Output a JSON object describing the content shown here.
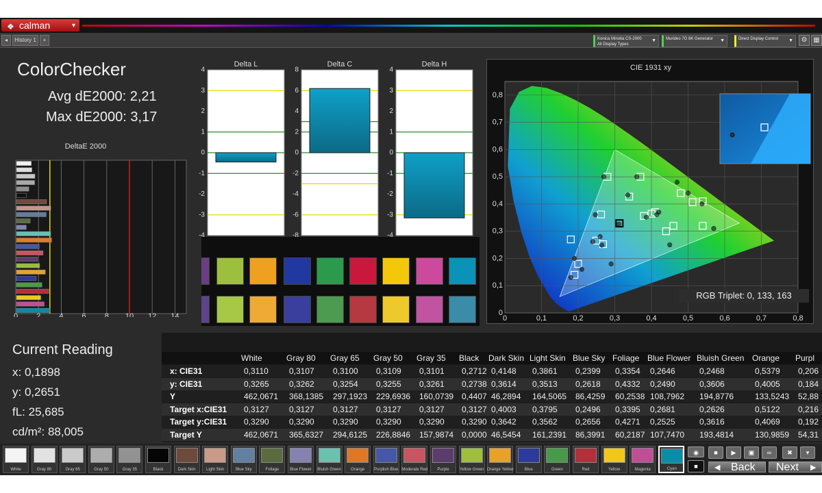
{
  "app": {
    "logo": "calman"
  },
  "tabs": {
    "history": "History 1",
    "add": "+"
  },
  "devices": {
    "meter": {
      "line1": "Konica Minolta CS-2000",
      "line2": "All Display Types"
    },
    "generator": {
      "line1": "Murideo 7G 8K Generator",
      "line2": ""
    },
    "display": {
      "line1": "Direct Display Control",
      "line2": ""
    }
  },
  "colorchecker": {
    "title": "ColorChecker",
    "avg": "Avg dE2000: 2,21",
    "max": "Max dE2000: 3,17"
  },
  "deltae_chart": {
    "title": "DeltaE 2000",
    "ticks": [
      "0",
      "2",
      "4",
      "6",
      "8",
      "10",
      "12",
      "14"
    ],
    "xlim": [
      0,
      15
    ],
    "thresholds": [
      {
        "value": 3,
        "color": "#e6d800"
      },
      {
        "value": 10,
        "color": "#d02020"
      }
    ],
    "bars": [
      {
        "name": "White",
        "value": 1.3694,
        "color": "#f2f2f2"
      },
      {
        "name": "Gray 80",
        "value": 1.4193,
        "color": "#dedede"
      },
      {
        "name": "Gray 65",
        "value": 1.6878,
        "color": "#c6c6c6"
      },
      {
        "name": "Gray 50",
        "value": 1.6602,
        "color": "#a9a9a9"
      },
      {
        "name": "Gray 35",
        "value": 1.1564,
        "color": "#8e8e8e"
      },
      {
        "name": "Black",
        "value": 0.9417,
        "color": "#101010"
      },
      {
        "name": "Dark Skin",
        "value": 2.7084,
        "color": "#6e4b3d"
      },
      {
        "name": "Light Skin",
        "value": 3.0778,
        "color": "#c69684"
      },
      {
        "name": "Blue Sky",
        "value": 2.6777,
        "color": "#5f7ea5"
      },
      {
        "name": "Foliage",
        "value": 1.2718,
        "color": "#5a6d3f"
      },
      {
        "name": "Blue Flower",
        "value": 0.9271,
        "color": "#8684b4"
      },
      {
        "name": "Bluish Green",
        "value": 3.0726,
        "color": "#67c1ae"
      },
      {
        "name": "Orange",
        "value": 3.1534,
        "color": "#e07a27"
      },
      {
        "name": "Purplish Blue",
        "value": 2.06,
        "color": "#4358a8"
      },
      {
        "name": "Moderate Red",
        "value": 2.4,
        "color": "#c95563"
      },
      {
        "name": "Purple",
        "value": 1.9,
        "color": "#5a3c6c"
      },
      {
        "name": "Yellow Green",
        "value": 2.1,
        "color": "#9dbb3c"
      },
      {
        "name": "Orange Yellow",
        "value": 2.6,
        "color": "#e9a12a"
      },
      {
        "name": "Blue",
        "value": 1.8,
        "color": "#2b3a9a"
      },
      {
        "name": "Green",
        "value": 2.3,
        "color": "#4a9a4a"
      },
      {
        "name": "Red",
        "value": 2.9,
        "color": "#b3303a"
      },
      {
        "name": "Yellow",
        "value": 2.2,
        "color": "#efc81f"
      },
      {
        "name": "Magenta",
        "value": 2.5,
        "color": "#c04f97"
      },
      {
        "name": "Cyan",
        "value": 3.0,
        "color": "#0e88aa"
      }
    ]
  },
  "delta_charts": [
    {
      "title": "Delta L",
      "ticks": [
        "4",
        "3",
        "2",
        "1",
        "0",
        "-1",
        "-2",
        "-3",
        "-4"
      ],
      "ylim": [
        -4,
        4
      ],
      "value": -0.45
    },
    {
      "title": "Delta C",
      "ticks": [
        "8",
        "6",
        "4",
        "2",
        "0",
        "-2",
        "-4",
        "-6",
        "-8"
      ],
      "ylim": [
        -8,
        8
      ],
      "value": 6.2
    },
    {
      "title": "Delta H",
      "ticks": [
        "4",
        "3",
        "2",
        "1",
        "0",
        "-1",
        "-2",
        "-3",
        "-4"
      ],
      "ylim": [
        -4,
        4
      ],
      "value": -3.15
    }
  ],
  "swatch_rows": {
    "top": [
      "#6a3e80",
      "#9cc03e",
      "#f0a020",
      "#2038a0",
      "#2c9a4c",
      "#c8193c",
      "#f5c70a",
      "#cc4a9e",
      "#0a92b8"
    ],
    "bottom": [
      "#5c4488",
      "#a6c846",
      "#eeaa35",
      "#3a3f9e",
      "#4d9b50",
      "#b63840",
      "#eec92c",
      "#c054a0",
      "#3a8ca8"
    ],
    "labels": [
      "le",
      "Yellow Green",
      "Orange Yellow",
      "Blue",
      "Green",
      "Red",
      "Yellow",
      "Magenta",
      "Cyan"
    ]
  },
  "cie": {
    "title": "CIE 1931 xy",
    "xticks": [
      "0",
      "0,1",
      "0,2",
      "0,3",
      "0,4",
      "0,5",
      "0,6",
      "0,7",
      "0,8"
    ],
    "yticks": [
      "0,8",
      "0,7",
      "0,6",
      "0,5",
      "0,4",
      "0,3",
      "0,2",
      "0,1",
      "0"
    ],
    "rgb_triplet": "RGB Triplet: 0, 133, 163",
    "targets": [
      [
        0.3127,
        0.329
      ],
      [
        0.4003,
        0.3642
      ],
      [
        0.3795,
        0.3562
      ],
      [
        0.2496,
        0.2656
      ],
      [
        0.3395,
        0.4271
      ],
      [
        0.2681,
        0.2525
      ],
      [
        0.2626,
        0.3616
      ],
      [
        0.5122,
        0.4069
      ],
      [
        0.2,
        0.18
      ],
      [
        0.44,
        0.3
      ],
      [
        0.19,
        0.14
      ],
      [
        0.48,
        0.44
      ],
      [
        0.54,
        0.41
      ],
      [
        0.37,
        0.5
      ],
      [
        0.54,
        0.32
      ],
      [
        0.41,
        0.37
      ],
      [
        0.28,
        0.5
      ],
      [
        0.18,
        0.27
      ],
      [
        0.46,
        0.32
      ]
    ],
    "measured": [
      [
        0.311,
        0.3265
      ],
      [
        0.4148,
        0.3614
      ],
      [
        0.3861,
        0.3513
      ],
      [
        0.2399,
        0.2618
      ],
      [
        0.3354,
        0.4332
      ],
      [
        0.2646,
        0.249
      ],
      [
        0.2468,
        0.3606
      ],
      [
        0.5379,
        0.4005
      ],
      [
        0.19,
        0.2
      ],
      [
        0.45,
        0.25
      ],
      [
        0.18,
        0.13
      ],
      [
        0.47,
        0.48
      ],
      [
        0.57,
        0.31
      ],
      [
        0.36,
        0.5
      ],
      [
        0.5,
        0.44
      ],
      [
        0.42,
        0.37
      ],
      [
        0.27,
        0.5
      ],
      [
        0.26,
        0.28
      ],
      [
        0.21,
        0.16
      ],
      [
        0.29,
        0.18
      ]
    ],
    "current": [
      0.1898,
      0.2651
    ]
  },
  "current_reading": {
    "title": "Current Reading",
    "x": "x: 0,1898",
    "y": "y: 0,2651",
    "fl": "fL: 25,685",
    "cdm": "cd/m²: 88,005"
  },
  "table": {
    "columns": [
      "White",
      "Gray 80",
      "Gray 65",
      "Gray 50",
      "Gray 35",
      "Black",
      "Dark Skin",
      "Light Skin",
      "Blue Sky",
      "Foliage",
      "Blue Flower",
      "Bluish Green",
      "Orange",
      "Purpl"
    ],
    "rows": [
      {
        "label": "x: CIE31",
        "cells": [
          "0,3110",
          "0,3107",
          "0,3100",
          "0,3109",
          "0,3101",
          "0,2712",
          "0,4148",
          "0,3861",
          "0,2399",
          "0,3354",
          "0,2646",
          "0,2468",
          "0,5379",
          "0,206"
        ]
      },
      {
        "label": "y: CIE31",
        "cells": [
          "0,3265",
          "0,3262",
          "0,3254",
          "0,3255",
          "0,3261",
          "0,2738",
          "0,3614",
          "0,3513",
          "0,2618",
          "0,4332",
          "0,2490",
          "0,3606",
          "0,4005",
          "0,184"
        ]
      },
      {
        "label": "Y",
        "cells": [
          "462,0671",
          "368,1385",
          "297,1923",
          "229,6936",
          "160,0739",
          "0,4407",
          "46,2894",
          "164,5065",
          "86,4259",
          "60,2538",
          "108,7962",
          "194,8776",
          "133,5243",
          "52,88"
        ]
      },
      {
        "label": "Target x:CIE31",
        "cells": [
          "0,3127",
          "0,3127",
          "0,3127",
          "0,3127",
          "0,3127",
          "0,3127",
          "0,4003",
          "0,3795",
          "0,2496",
          "0,3395",
          "0,2681",
          "0,2626",
          "0,5122",
          "0,216"
        ]
      },
      {
        "label": "Target y:CIE31",
        "cells": [
          "0,3290",
          "0,3290",
          "0,3290",
          "0,3290",
          "0,3290",
          "0,3290",
          "0,3642",
          "0,3562",
          "0,2656",
          "0,4271",
          "0,2525",
          "0,3616",
          "0,4069",
          "0,192"
        ]
      },
      {
        "label": "Target Y",
        "cells": [
          "462,0671",
          "365,6327",
          "294,6125",
          "226,8846",
          "157,9874",
          "0,0000",
          "46,5454",
          "161,2391",
          "86,3991",
          "60,2187",
          "107,7470",
          "193,4814",
          "130,9859",
          "54,31"
        ]
      },
      {
        "label": "ΔE 2000",
        "cells": [
          "1,3694",
          "1,4193",
          "1,6878",
          "1,6602",
          "1,1564",
          "0,9417",
          "2,7084",
          "3,0778",
          "2,6777",
          "1,2718",
          "0,9271",
          "3,0726",
          "3,1534",
          "2,063"
        ]
      }
    ]
  },
  "bottom_swatches": [
    {
      "label": "White",
      "color": "#f4f4f4"
    },
    {
      "label": "Gray 80",
      "color": "#e2e2e2"
    },
    {
      "label": "Gray 65",
      "color": "#cacaca"
    },
    {
      "label": "Gray 50",
      "color": "#adadad"
    },
    {
      "label": "Gray 35",
      "color": "#929292"
    },
    {
      "label": "Black",
      "color": "#050505"
    },
    {
      "label": "Dark Skin",
      "color": "#6d4a3c"
    },
    {
      "label": "Light Skin",
      "color": "#c99a88"
    },
    {
      "label": "Blue Sky",
      "color": "#62809f"
    },
    {
      "label": "Foliage",
      "color": "#5b6b40"
    },
    {
      "label": "Blue Flower",
      "color": "#8582b2"
    },
    {
      "label": "Bluish Green",
      "color": "#6ac2ae"
    },
    {
      "label": "Orange",
      "color": "#de7826"
    },
    {
      "label": "Purplish Blue",
      "color": "#4657a6"
    },
    {
      "label": "Moderate Red",
      "color": "#c85562"
    },
    {
      "label": "Purple",
      "color": "#5c3c6c"
    },
    {
      "label": "Yellow Green",
      "color": "#9fbe3d"
    },
    {
      "label": "Orange Yellow",
      "color": "#e8a22a"
    },
    {
      "label": "Blue",
      "color": "#2c3a9a"
    },
    {
      "label": "Green",
      "color": "#479a4a"
    },
    {
      "label": "Red",
      "color": "#b2303a"
    },
    {
      "label": "Yellow",
      "color": "#efc81f"
    },
    {
      "label": "Magenta",
      "color": "#be4f96"
    },
    {
      "label": "Cyan",
      "color": "#0a8ea8"
    }
  ],
  "nav": {
    "back": "Back",
    "next": "Next"
  }
}
